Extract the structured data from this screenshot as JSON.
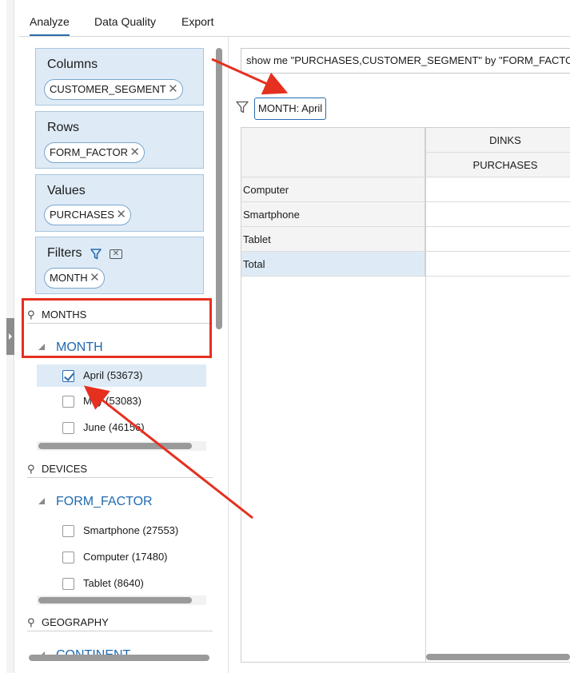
{
  "tabs": [
    {
      "label": "Analyze",
      "active": true
    },
    {
      "label": "Data Quality",
      "active": false
    },
    {
      "label": "Export",
      "active": false
    }
  ],
  "wells": {
    "columns": {
      "title": "Columns",
      "pill": "CUSTOMER_SEGMENT"
    },
    "rows": {
      "title": "Rows",
      "pill": "FORM_FACTOR"
    },
    "values": {
      "title": "Values",
      "pill": "PURCHASES"
    },
    "filters": {
      "title": "Filters",
      "pill": "MONTH"
    }
  },
  "tree": {
    "months": {
      "hierarchy": "MONTHS",
      "level": "MONTH",
      "members": [
        {
          "label": "April (53673)",
          "checked": true
        },
        {
          "label": "May (53083)",
          "checked": false
        },
        {
          "label": "June (46156)",
          "checked": false
        }
      ]
    },
    "devices": {
      "hierarchy": "DEVICES",
      "level": "FORM_FACTOR",
      "members": [
        {
          "label": "Smartphone (27553)",
          "checked": false
        },
        {
          "label": "Computer (17480)",
          "checked": false
        },
        {
          "label": "Tablet (8640)",
          "checked": false
        }
      ]
    },
    "geography": {
      "hierarchy": "GEOGRAPHY",
      "level": "CONTINENT"
    }
  },
  "query": {
    "text": "show me \"PURCHASES,CUSTOMER_SEGMENT\" by \"FORM_FACTOR\""
  },
  "filter_chip": {
    "label": "MONTH: April"
  },
  "grid": {
    "column_group": "DINKS",
    "measure": "PURCHASES",
    "rows": [
      "Computer",
      "Smartphone",
      "Tablet",
      "Total"
    ]
  },
  "colors": {
    "accent": "#2a6db0",
    "annotation": "#e53020",
    "well_bg": "#deebf6"
  }
}
